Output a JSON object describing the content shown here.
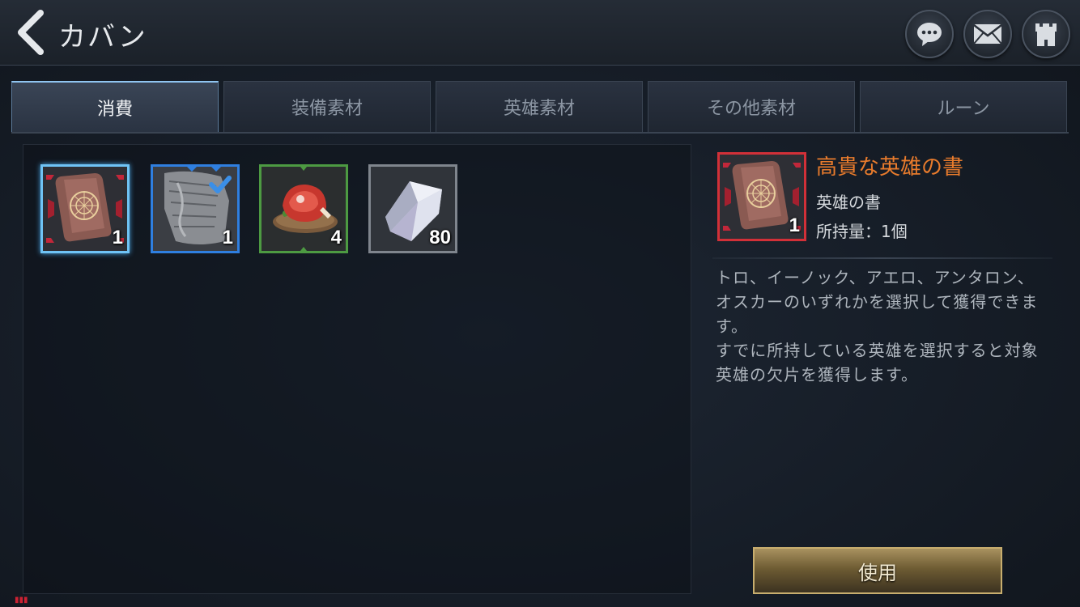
{
  "header": {
    "title": "カバン",
    "icons": [
      "chat-icon",
      "mail-icon",
      "castle-icon"
    ]
  },
  "tabs": [
    {
      "label": "消費",
      "active": true
    },
    {
      "label": "装備素材",
      "active": false
    },
    {
      "label": "英雄素材",
      "active": false
    },
    {
      "label": "その他素材",
      "active": false
    },
    {
      "label": "ルーン",
      "active": false
    }
  ],
  "items": [
    {
      "icon": "scroll-icon",
      "count": "1",
      "border": "#6fc3f5",
      "selected": true
    },
    {
      "icon": "stone-tablet-icon",
      "count": "1",
      "border": "#2f7fe0",
      "checked": true
    },
    {
      "icon": "meat-icon",
      "count": "4",
      "border": "#4d9a42"
    },
    {
      "icon": "crystal-icon",
      "count": "80",
      "border": "#7f858d"
    }
  ],
  "detail": {
    "name": "高貴な英雄の書",
    "type": "英雄の書",
    "quantity": "所持量：1個",
    "count": "1",
    "description": "トロ、イーノック、アエロ、アンタロン、オスカーのいずれかを選択して獲得できます。\nすでに所持している英雄を選択すると対象英雄の欠片を獲得します。",
    "use_label": "使用",
    "name_color": "#e87b2c"
  }
}
